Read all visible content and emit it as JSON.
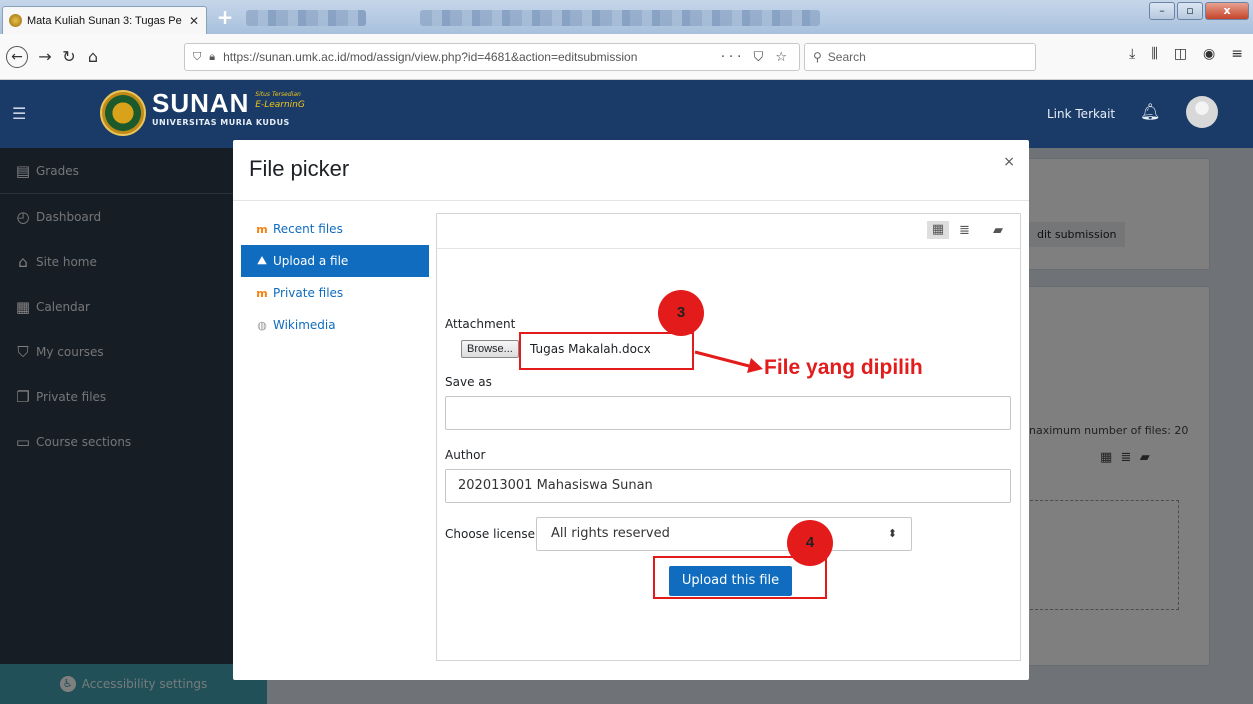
{
  "browser": {
    "tab_title": "Mata Kuliah Sunan 3: Tugas Pe",
    "tab_close": "✕",
    "new_tab": "+",
    "url": "https://sunan.umk.ac.id/mod/assign/view.php?id=4681&action=editsubmission",
    "search_placeholder": "Search",
    "url_actions": "··· ⛉ ☆"
  },
  "header": {
    "logo_text": "SUNAN",
    "logo_tagline_small": "Situs Tersedian",
    "logo_tagline": "E-LearninG",
    "logo_subtitle": "UNIVERSITAS MURIA KUDUS",
    "link_terkait": "Link Terkait"
  },
  "sidebar": {
    "items": [
      {
        "label": "Grades",
        "icon": "grades-icon"
      },
      {
        "label": "Dashboard",
        "icon": "dashboard-icon"
      },
      {
        "label": "Site home",
        "icon": "home-icon"
      },
      {
        "label": "Calendar",
        "icon": "calendar-icon"
      },
      {
        "label": "My courses",
        "icon": "courses-icon"
      },
      {
        "label": "Private files",
        "icon": "files-icon"
      },
      {
        "label": "Course sections",
        "icon": "folder-icon"
      }
    ],
    "accessibility": "Accessibility settings"
  },
  "background_page": {
    "edit_submission": "dit submission",
    "max_files_text": "naximum number of files: 20"
  },
  "modal": {
    "title": "File picker",
    "close": "×",
    "repositories": [
      {
        "label": "Recent files",
        "icon": "moodle-icon",
        "active": false
      },
      {
        "label": "Upload a file",
        "icon": "upload-icon",
        "active": true
      },
      {
        "label": "Private files",
        "icon": "moodle-icon",
        "active": false
      },
      {
        "label": "Wikimedia",
        "icon": "wikimedia-icon",
        "active": false
      }
    ],
    "form": {
      "attachment_label": "Attachment",
      "browse_label": "Browse...",
      "selected_file": "Tugas Makalah.docx",
      "save_as_label": "Save as",
      "save_as_value": "",
      "author_label": "Author",
      "author_value": "202013001 Mahasiswa Sunan",
      "license_label": "Choose license",
      "license_value": "All rights reserved",
      "upload_button": "Upload this file"
    }
  },
  "annotations": {
    "badge_3": "3",
    "badge_4": "4",
    "callout": "File yang dipilih",
    "color": "#e31b1b"
  }
}
